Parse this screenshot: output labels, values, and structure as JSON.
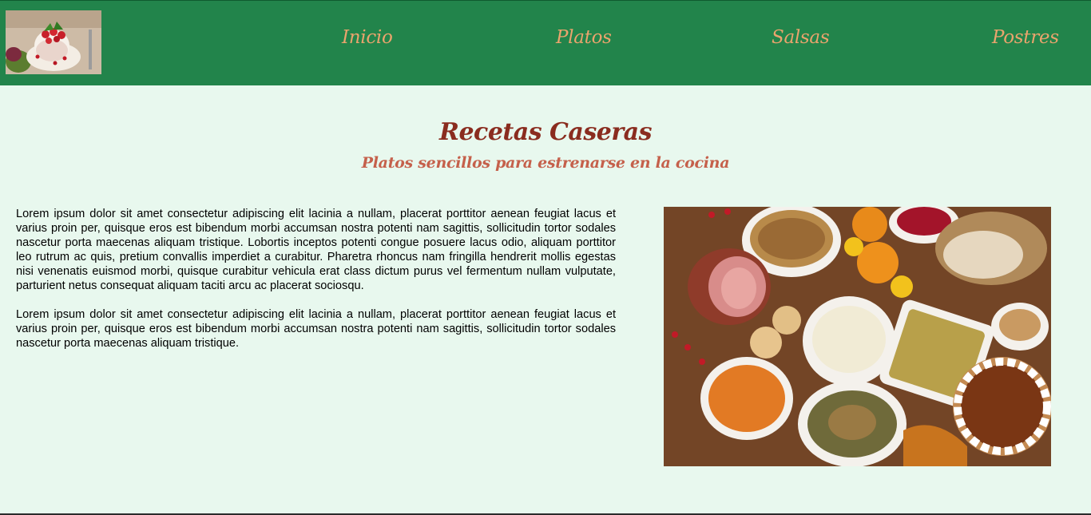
{
  "nav": {
    "items": [
      {
        "label": "Inicio"
      },
      {
        "label": "Platos"
      },
      {
        "label": "Salsas"
      },
      {
        "label": "Postres"
      }
    ]
  },
  "hero": {
    "title": "Recetas Caseras",
    "subtitle": "Platos sencillos para estrenarse en la cocina"
  },
  "content": {
    "paragraphs": [
      "Lorem ipsum dolor sit amet consectetur adipiscing elit lacinia a nullam, placerat porttitor aenean feugiat lacus et varius proin per, quisque eros est bibendum morbi accumsan nostra potenti nam sagittis, sollicitudin tortor sodales nascetur porta maecenas aliquam tristique. Lobortis inceptos potenti congue posuere lacus odio, aliquam porttitor leo rutrum ac quis, pretium convallis imperdiet a curabitur. Pharetra rhoncus nam fringilla hendrerit mollis egestas nisi venenatis euismod morbi, quisque curabitur vehicula erat class dictum purus vel fermentum nullam vulputate, parturient netus consequat aliquam taciti arcu ac placerat sociosqu.",
      "Lorem ipsum dolor sit amet consectetur adipiscing elit lacinia a nullam, placerat porttitor aenean feugiat lacus et varius proin per, quisque eros est bibendum morbi accumsan nostra potenti nam sagittis, sollicitudin tortor sodales nascetur porta maecenas aliquam tristique."
    ]
  },
  "colors": {
    "header": "#22844b",
    "page_bg": "#e8f8ee",
    "nav_text": "#eaa46d",
    "title": "#8a2c1f",
    "subtitle": "#c5604b"
  }
}
